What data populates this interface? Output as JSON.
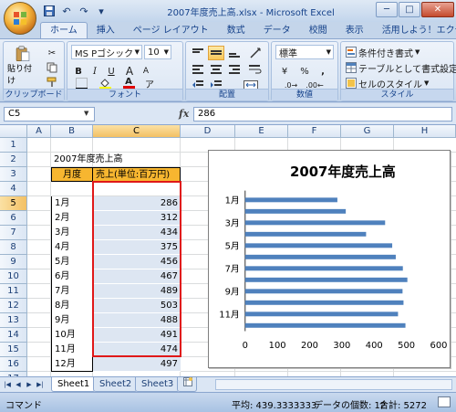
{
  "window": {
    "title": "2007年度売上高.xlsx - Microsoft Excel",
    "minimize": "─",
    "maximize": "□",
    "close": "✕"
  },
  "qat": {
    "save": "💾",
    "undo": "↶",
    "redo": "↷",
    "more": "▾"
  },
  "tabs": [
    "ホーム",
    "挿入",
    "ページ レイアウト",
    "数式",
    "データ",
    "校閲",
    "表示",
    "活用しよう！エクセル"
  ],
  "ribbon": {
    "clipboard": {
      "label": "クリップボード",
      "paste": "貼り付け"
    },
    "font": {
      "label": "フォント",
      "name": "MS Pゴシック",
      "size": "10",
      "bold": "B",
      "italic": "I",
      "underline": "U",
      "grow": "A",
      "shrink": "A",
      "color_a": "A",
      "phonetic": "ア"
    },
    "alignment": {
      "label": "配置"
    },
    "number": {
      "label": "数値",
      "format": "標準",
      "percent": "%",
      "comma": ",",
      "currency": "¥"
    },
    "styles": {
      "label": "スタイル",
      "conditional": "条件付き書式",
      "as_table": "テーブルとして書式設定",
      "cell_styles": "セルのスタイル"
    }
  },
  "formula_bar": {
    "name": "C5",
    "fx": "fx",
    "value": "286"
  },
  "grid": {
    "columns": [
      "A",
      "B",
      "C",
      "D",
      "E",
      "F",
      "G",
      "H"
    ],
    "rows": [
      "1",
      "2",
      "3",
      "4",
      "5",
      "6",
      "7",
      "8",
      "9",
      "10",
      "11",
      "12",
      "13",
      "14",
      "15",
      "16",
      "17",
      "18"
    ],
    "title": "2007年度売上高",
    "header_month": "月度",
    "header_sales": "売上(単位:百万円)",
    "months": [
      "1月",
      "2月",
      "3月",
      "4月",
      "5月",
      "6月",
      "7月",
      "8月",
      "9月",
      "10月",
      "11月",
      "12月"
    ],
    "sales": [
      "286",
      "312",
      "434",
      "375",
      "456",
      "467",
      "489",
      "503",
      "488",
      "491",
      "474",
      "497"
    ]
  },
  "chart_data": {
    "type": "bar",
    "title": "2007年度売上高",
    "categories": [
      "1月",
      "2月",
      "3月",
      "4月",
      "5月",
      "6月",
      "7月",
      "8月",
      "9月",
      "10月",
      "11月",
      "12月"
    ],
    "values": [
      286,
      312,
      434,
      375,
      456,
      467,
      489,
      503,
      488,
      491,
      474,
      497
    ],
    "category_labels_shown": [
      "1月",
      "3月",
      "5月",
      "7月",
      "9月",
      "11月"
    ],
    "x_ticks": [
      "0",
      "100",
      "200",
      "300",
      "400",
      "500",
      "600"
    ],
    "xlim": [
      0,
      600
    ],
    "bar_color": "#4f81bd"
  },
  "sheets": [
    "Sheet1",
    "Sheet2",
    "Sheet3"
  ],
  "status": {
    "mode": "コマンド",
    "average": "平均: 439.3333333",
    "count": "データの個数: 12",
    "sum": "合計: 5272"
  }
}
